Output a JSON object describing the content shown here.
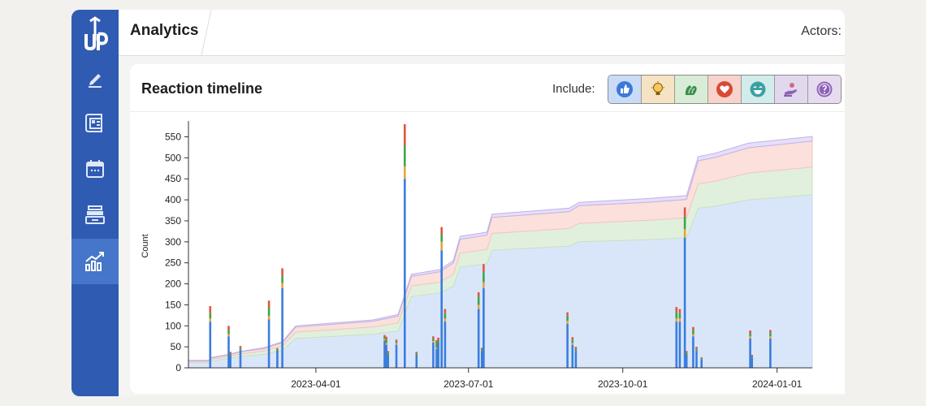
{
  "header": {
    "title": "Analytics",
    "actors_label": "Actors:"
  },
  "sidebar": {
    "logo": "up-arrow-logo",
    "items": [
      {
        "name": "pen-icon"
      },
      {
        "name": "layout-icon"
      },
      {
        "name": "calendar-icon"
      },
      {
        "name": "inbox-tray-icon"
      },
      {
        "name": "analytics-icon",
        "active": true
      }
    ]
  },
  "card": {
    "title": "Reaction timeline",
    "include_label": "Include:",
    "reactions": [
      {
        "name": "like",
        "icon": "thumbs-up-icon",
        "color": "#2f6fd6",
        "bg": "#c9dbf6"
      },
      {
        "name": "insightful",
        "icon": "lightbulb-icon",
        "color": "#b07a18",
        "bg": "#f6e3c3"
      },
      {
        "name": "celebrate",
        "icon": "clapping-hands-icon",
        "color": "#2f8f4a",
        "bg": "#d8ecd6"
      },
      {
        "name": "love",
        "icon": "heart-icon",
        "color": "#d4412f",
        "bg": "#f7d3cc"
      },
      {
        "name": "funny",
        "icon": "laughing-face-icon",
        "color": "#1f8a8f",
        "bg": "#d2ecea"
      },
      {
        "name": "support",
        "icon": "support-hand-icon",
        "color": "#7a4fb0",
        "bg": "#e2d8ee"
      },
      {
        "name": "curious",
        "icon": "curious-face-icon",
        "color": "#7a4fb0",
        "bg": "#e7dcef"
      }
    ]
  },
  "chart_data": {
    "type": "area",
    "xlabel": "",
    "ylabel": "Count",
    "x_range": [
      "2023-01-15",
      "2024-01-22"
    ],
    "ylim": [
      0,
      580
    ],
    "y_ticks": [
      0,
      50,
      100,
      150,
      200,
      250,
      300,
      350,
      400,
      450,
      500,
      550
    ],
    "x_ticks": [
      "2023-04-01",
      "2023-07-01",
      "2023-10-01",
      "2024-01-01"
    ],
    "colors": {
      "like": "#3b7ddd",
      "insightful": "#e7a33e",
      "celebrate": "#3fa34d",
      "love": "#e2553c",
      "other": "#a78bd0"
    },
    "cumulative": [
      {
        "date": "2023-01-15",
        "like": 12,
        "celebrate": 3,
        "love": 2,
        "other": 1
      },
      {
        "date": "2023-01-27",
        "like": 12,
        "celebrate": 3,
        "love": 2,
        "other": 1
      },
      {
        "date": "2023-01-29",
        "like": 17,
        "celebrate": 4,
        "love": 3,
        "other": 1
      },
      {
        "date": "2023-02-08",
        "like": 22,
        "celebrate": 5,
        "love": 4,
        "other": 1
      },
      {
        "date": "2023-02-15",
        "like": 27,
        "celebrate": 6,
        "love": 5,
        "other": 1
      },
      {
        "date": "2023-03-01",
        "like": 32,
        "celebrate": 8,
        "love": 6,
        "other": 2
      },
      {
        "date": "2023-03-12",
        "like": 42,
        "celebrate": 10,
        "love": 8,
        "other": 2
      },
      {
        "date": "2023-03-20",
        "like": 70,
        "celebrate": 15,
        "love": 12,
        "other": 3
      },
      {
        "date": "2023-05-05",
        "like": 80,
        "celebrate": 17,
        "love": 14,
        "other": 3
      },
      {
        "date": "2023-05-20",
        "like": 88,
        "celebrate": 19,
        "love": 16,
        "other": 4
      },
      {
        "date": "2023-05-28",
        "like": 170,
        "celebrate": 25,
        "love": 23,
        "other": 5
      },
      {
        "date": "2023-06-14",
        "like": 178,
        "celebrate": 26,
        "love": 25,
        "other": 5
      },
      {
        "date": "2023-06-22",
        "like": 195,
        "celebrate": 28,
        "love": 27,
        "other": 6
      },
      {
        "date": "2023-06-26",
        "like": 240,
        "celebrate": 33,
        "love": 33,
        "other": 7
      },
      {
        "date": "2023-07-12",
        "like": 248,
        "celebrate": 34,
        "love": 34,
        "other": 7
      },
      {
        "date": "2023-07-15",
        "like": 280,
        "celebrate": 40,
        "love": 38,
        "other": 8
      },
      {
        "date": "2023-08-30",
        "like": 290,
        "celebrate": 42,
        "love": 40,
        "other": 8
      },
      {
        "date": "2023-09-05",
        "like": 300,
        "celebrate": 44,
        "love": 42,
        "other": 8
      },
      {
        "date": "2023-10-15",
        "like": 305,
        "celebrate": 46,
        "love": 43,
        "other": 9
      },
      {
        "date": "2023-11-08",
        "like": 310,
        "celebrate": 47,
        "love": 44,
        "other": 9
      },
      {
        "date": "2023-11-15",
        "like": 380,
        "celebrate": 58,
        "love": 55,
        "other": 10
      },
      {
        "date": "2023-11-25",
        "like": 385,
        "celebrate": 59,
        "love": 57,
        "other": 10
      },
      {
        "date": "2023-12-15",
        "like": 400,
        "celebrate": 64,
        "love": 60,
        "other": 11
      },
      {
        "date": "2024-01-22",
        "like": 412,
        "celebrate": 66,
        "love": 62,
        "other": 11
      }
    ],
    "daily": [
      {
        "date": "2023-01-28",
        "like": 110,
        "insightful": 8,
        "celebrate": 12,
        "love": 17
      },
      {
        "date": "2023-02-08",
        "like": 75,
        "insightful": 5,
        "celebrate": 10,
        "love": 10
      },
      {
        "date": "2023-02-09",
        "like": 30,
        "celebrate": 4,
        "love": 4
      },
      {
        "date": "2023-02-15",
        "like": 42,
        "celebrate": 5,
        "love": 5
      },
      {
        "date": "2023-03-04",
        "like": 115,
        "insightful": 8,
        "celebrate": 20,
        "love": 17
      },
      {
        "date": "2023-03-09",
        "like": 42,
        "celebrate": 3,
        "love": 2
      },
      {
        "date": "2023-03-12",
        "like": 190,
        "insightful": 12,
        "celebrate": 17,
        "love": 18
      },
      {
        "date": "2023-05-12",
        "like": 65,
        "insightful": 4,
        "celebrate": 5,
        "love": 4
      },
      {
        "date": "2023-05-13",
        "like": 55,
        "insightful": 4,
        "celebrate": 8,
        "love": 7
      },
      {
        "date": "2023-05-14",
        "like": 30,
        "celebrate": 5,
        "love": 5
      },
      {
        "date": "2023-05-19",
        "like": 55,
        "insightful": 4,
        "celebrate": 4,
        "love": 4
      },
      {
        "date": "2023-05-24",
        "like": 450,
        "insightful": 30,
        "celebrate": 50,
        "love": 50
      },
      {
        "date": "2023-05-31",
        "like": 30,
        "celebrate": 4,
        "love": 4
      },
      {
        "date": "2023-06-10",
        "like": 60,
        "insightful": 4,
        "celebrate": 6,
        "love": 5
      },
      {
        "date": "2023-06-12",
        "like": 45,
        "insightful": 3,
        "celebrate": 10,
        "love": 8
      },
      {
        "date": "2023-06-13",
        "like": 60,
        "celebrate": 6,
        "love": 6
      },
      {
        "date": "2023-06-15",
        "like": 280,
        "insightful": 20,
        "celebrate": 18,
        "love": 17
      },
      {
        "date": "2023-06-17",
        "like": 110,
        "insightful": 8,
        "celebrate": 12,
        "love": 10
      },
      {
        "date": "2023-07-07",
        "like": 140,
        "insightful": 10,
        "celebrate": 20,
        "love": 10
      },
      {
        "date": "2023-07-09",
        "like": 40,
        "celebrate": 4,
        "love": 4
      },
      {
        "date": "2023-07-10",
        "like": 190,
        "insightful": 14,
        "celebrate": 24,
        "love": 19
      },
      {
        "date": "2023-08-29",
        "like": 105,
        "insightful": 7,
        "celebrate": 12,
        "love": 8
      },
      {
        "date": "2023-09-01",
        "like": 55,
        "insightful": 4,
        "celebrate": 8,
        "love": 6
      },
      {
        "date": "2023-09-03",
        "like": 40,
        "celebrate": 5,
        "love": 5
      },
      {
        "date": "2023-11-02",
        "like": 110,
        "insightful": 8,
        "celebrate": 15,
        "love": 12
      },
      {
        "date": "2023-11-04",
        "like": 110,
        "insightful": 8,
        "celebrate": 12,
        "love": 10
      },
      {
        "date": "2023-11-07",
        "like": 310,
        "insightful": 20,
        "celebrate": 30,
        "love": 22
      },
      {
        "date": "2023-11-08",
        "like": 30,
        "celebrate": 5,
        "love": 5
      },
      {
        "date": "2023-11-12",
        "like": 75,
        "insightful": 5,
        "celebrate": 10,
        "love": 7
      },
      {
        "date": "2023-11-14",
        "like": 40,
        "celebrate": 5,
        "love": 5
      },
      {
        "date": "2023-11-17",
        "like": 20,
        "celebrate": 3,
        "love": 2
      },
      {
        "date": "2023-12-16",
        "like": 70,
        "insightful": 5,
        "celebrate": 6,
        "love": 8
      },
      {
        "date": "2023-12-17",
        "like": 25,
        "celebrate": 3,
        "love": 3
      },
      {
        "date": "2023-12-28",
        "like": 70,
        "insightful": 5,
        "celebrate": 8,
        "love": 7
      }
    ]
  }
}
